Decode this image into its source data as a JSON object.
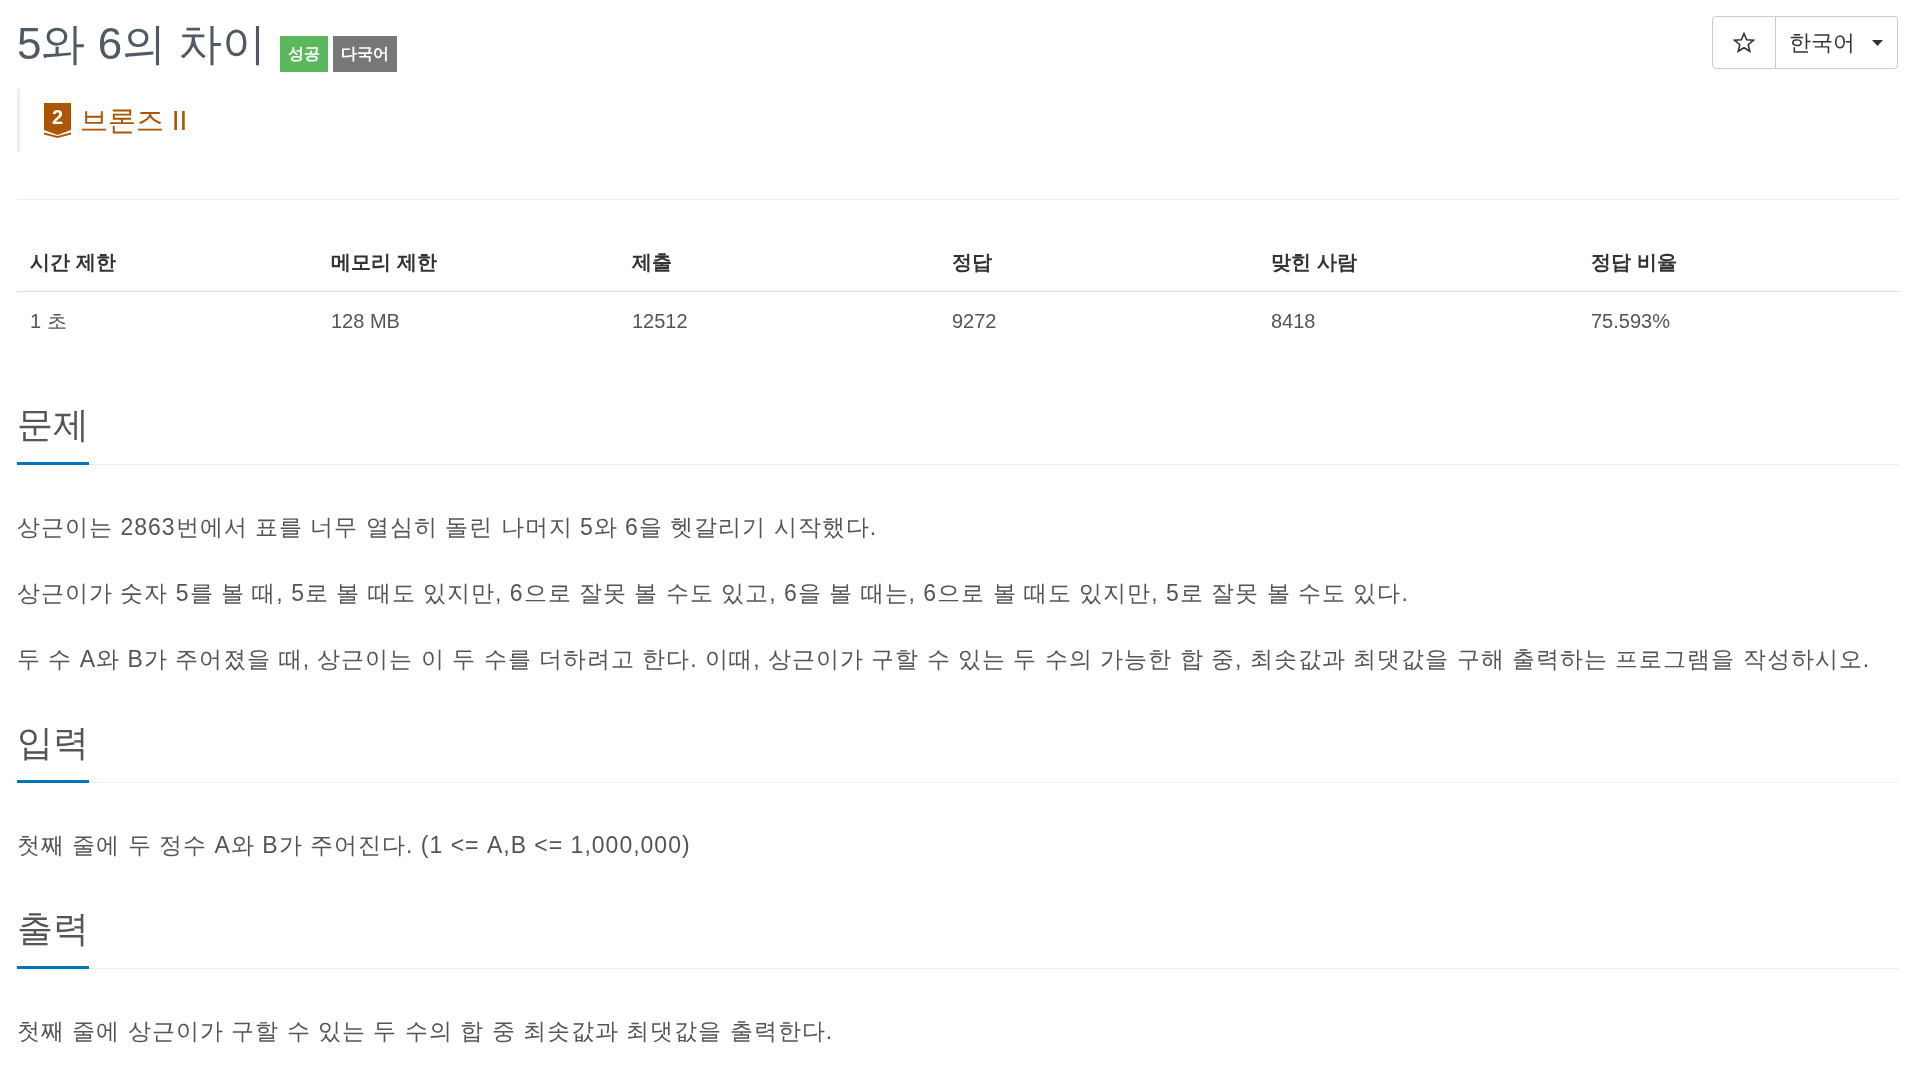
{
  "title": "5와 6의 차이",
  "badges": [
    {
      "label": "성공",
      "color": "#5cb85c"
    },
    {
      "label": "다국어",
      "color": "#777777"
    }
  ],
  "tier": {
    "icon_text": "2",
    "label": "브론즈 II"
  },
  "toolbar": {
    "favorite": {
      "starred": false
    },
    "language": {
      "value": "한국어"
    }
  },
  "table": {
    "columns": [
      "시간 제한",
      "메모리 제한",
      "제출",
      "정답",
      "맞힌 사람",
      "정답 비율"
    ],
    "rows": [
      [
        "1 초",
        "128 MB",
        "12512",
        "9272",
        "8418",
        "75.593%"
      ]
    ]
  },
  "sections": [
    {
      "heading": "문제",
      "paragraphs": [
        "상근이는 2863번에서 표를 너무 열심히 돌린 나머지 5와 6을 헷갈리기 시작했다.",
        "상근이가 숫자 5를 볼 때, 5로 볼 때도 있지만, 6으로 잘못 볼 수도 있고, 6을 볼 때는, 6으로 볼 때도 있지만, 5로 잘못 볼 수도 있다.",
        "두 수 A와 B가 주어졌을 때, 상근이는 이 두 수를 더하려고 한다. 이때, 상근이가 구할 수 있는 두 수의 가능한 합 중, 최솟값과 최댓값을 구해 출력하는 프로그램을 작성하시오."
      ]
    },
    {
      "heading": "입력",
      "paragraphs": [
        "첫째 줄에 두 정수 A와 B가 주어진다. (1 <= A,B <= 1,000,000)"
      ]
    },
    {
      "heading": "출력",
      "paragraphs": [
        "첫째 줄에 상근이가 구할 수 있는 두 수의 합 중 최솟값과 최댓값을 출력한다."
      ]
    }
  ]
}
